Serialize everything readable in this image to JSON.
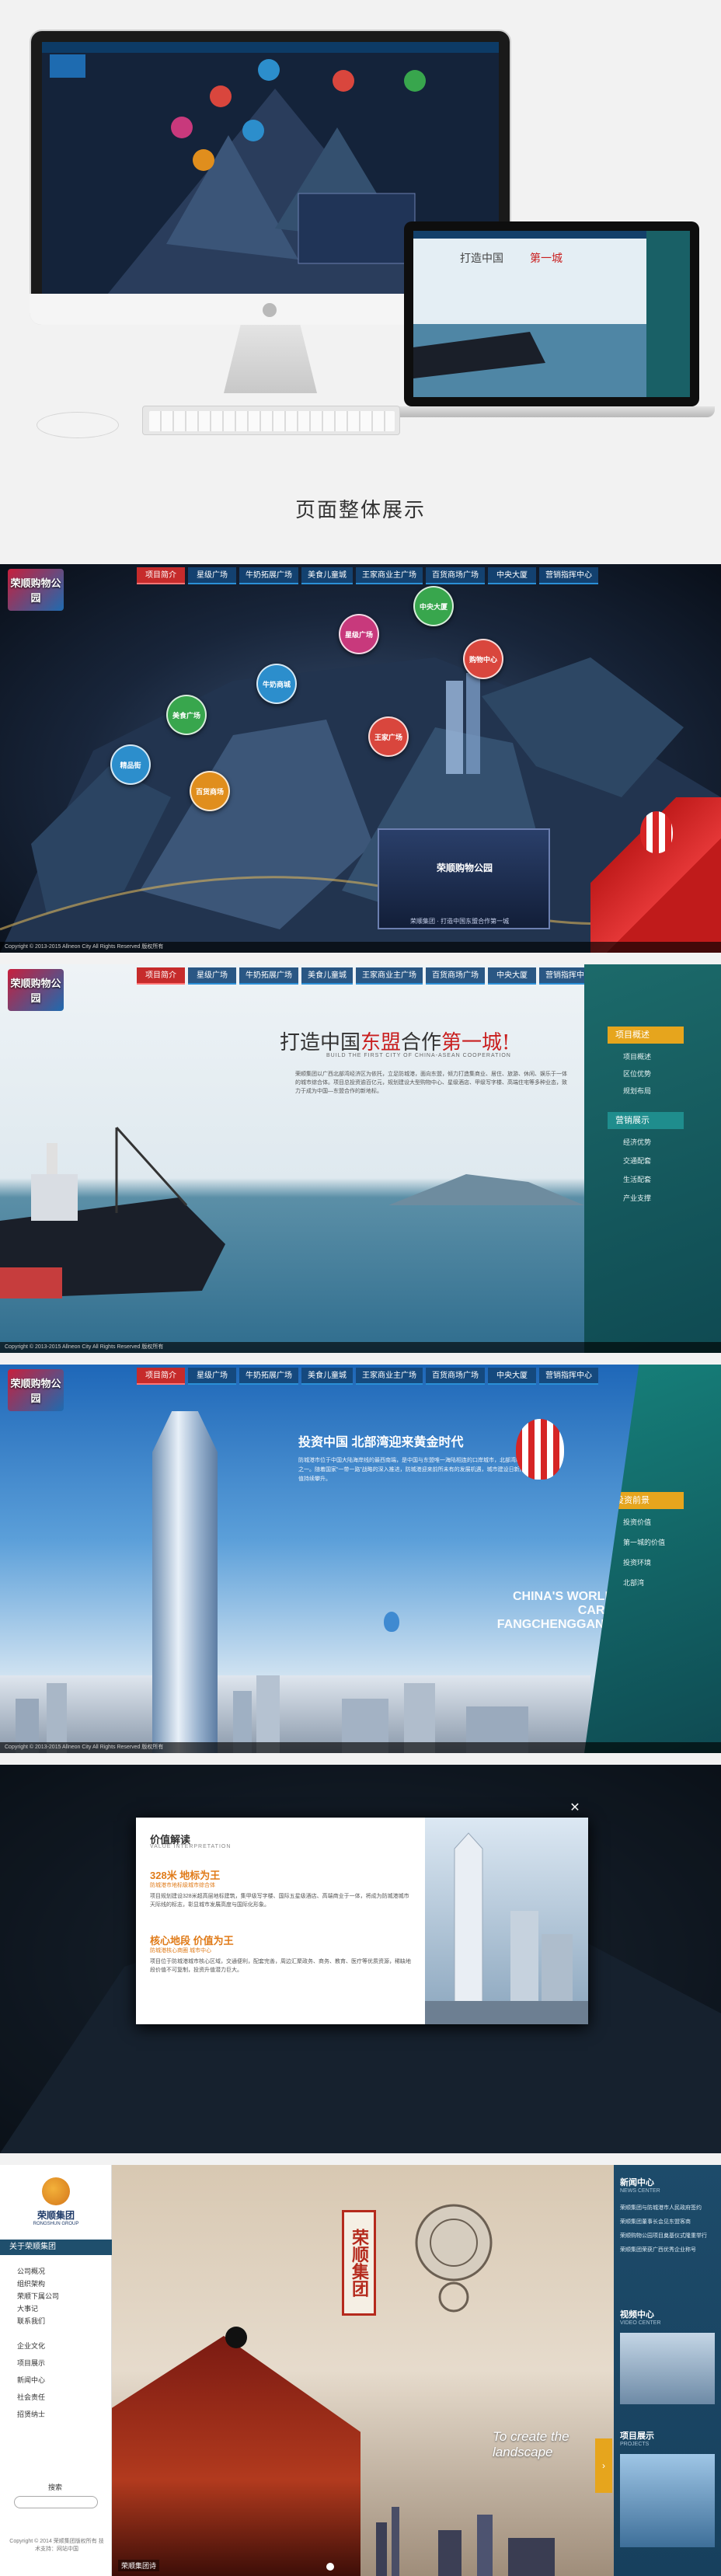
{
  "hero": {
    "caption": "页面整体展示"
  },
  "site": {
    "logo": "荣顺购物公园",
    "nav": [
      "项目简介",
      "星级广场",
      "牛奶拓展广场",
      "美食儿童城",
      "王家商业主广场",
      "百货商场广场",
      "中央大厦",
      "营销指挥中心"
    ],
    "footer": "Copyright © 2013-2015 Allneon City All Rights Reserved 版权所有"
  },
  "map_panel": {
    "bubbles": [
      "中央大厦",
      "购物中心",
      "星级广场",
      "牛奶商城",
      "美食广场",
      "精品街",
      "百货商场",
      "王家广场"
    ],
    "video": {
      "title": "荣顺购物公园",
      "subtitle": "荣顺集团 · 打造中国东盟合作第一城"
    }
  },
  "ship_panel": {
    "headline_a": "打造中国",
    "headline_b": "东盟",
    "headline_c": "合作",
    "headline_d": "第一城!",
    "headline_en": "BUILD THE FIRST CITY OF CHINA-ASEAN COOPERATION",
    "body": "荣顺集团以广西北部湾经济区为依托，立足防城港，面向东盟，倾力打造集商业、居住、旅游、休闲、娱乐于一体的城市综合体。项目总投资逾百亿元，规划建设大型购物中心、星级酒店、甲级写字楼、高端住宅等多种业态，致力于成为中国—东盟合作的新地标。",
    "menu_heads": [
      "项目概述",
      "营销展示"
    ],
    "menu_items": [
      "项目概述",
      "区位优势",
      "规划布局",
      "经济优势",
      "交通配套",
      "生活配套",
      "产业支撑"
    ]
  },
  "invest_panel": {
    "title": "投资中国 北部湾迎来黄金时代",
    "body": "防城港市位于中国大陆海岸线的最西南端，是中国与东盟唯一海陆相连的口岸城市，北部湾经济区核心城市之一。随着国家“一带一路”战略的深入推进，防城港迎来前所未有的发展机遇，城市建设日新月异，投资价值持续攀升。",
    "slogan": "CHINA'S WORLD CARD FANGCHENGGANG",
    "menu_head": "投资前景",
    "menu_items": [
      "投资价值",
      "第一城的价值",
      "投资环境",
      "北部湾"
    ]
  },
  "modal_panel": {
    "title": "价值解读",
    "subtitle": "VALUE INTERPRETATION",
    "h1": "328米 地标为王",
    "h1_sub": "防城港市地标级城市综合体",
    "p1": "项目规划建设328米超高层地标建筑，集甲级写字楼、国际五星级酒店、高端商业于一体，将成为防城港城市天际线的标志，彰显城市发展高度与国际化形象。",
    "h2": "核心地段 价值为王",
    "h2_sub": "防城港核心商圈 城市中心",
    "p2": "项目位于防城港城市核心区域，交通便利，配套完善，周边汇聚政务、商务、教育、医疗等优质资源，稀缺地段价值不可复制，投资升值潜力巨大。",
    "close": "✕"
  },
  "group_panel": {
    "brand": "荣顺集团",
    "brand_en": "RONGSHUN GROUP",
    "band": "关于荣顺集团",
    "items": [
      "公司概况",
      "组织架构",
      "荣顺下属公司",
      "大事记",
      "联系我们",
      "企业文化",
      "项目展示",
      "新闻中心",
      "社会责任",
      "招贤纳士"
    ],
    "search_label": "搜索",
    "copyright": "Copyright © 2014 荣顺集团版权所有  技术支持：网站中国",
    "vert_brand": "荣顺集团",
    "slogan": "To create the landscape",
    "tag": "荣顺集团诗",
    "right": {
      "news_head": "新闻中心",
      "news_sub": "NEWS CENTER",
      "news": [
        "荣顺集团与防城港市人民政府签约",
        "荣顺集团董事长会见东盟客商",
        "荣顺购物公园项目奠基仪式隆重举行",
        "荣顺集团荣获广西优秀企业称号"
      ],
      "proj_head": "视频中心",
      "proj_sub": "VIDEO CENTER",
      "show_head": "项目展示",
      "show_sub": "PROJECTS"
    }
  }
}
